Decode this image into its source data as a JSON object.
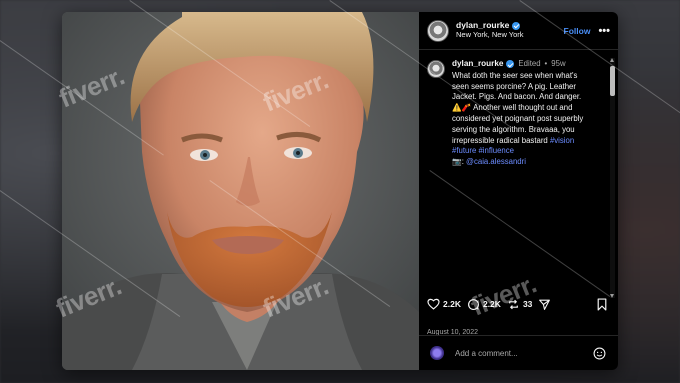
{
  "post": {
    "username": "dylan_rourke",
    "location": "New York, New York",
    "follow_label": "Follow",
    "more_label": "•••",
    "caption": {
      "username": "dylan_rourke",
      "edited": "Edited",
      "dot": "•",
      "age": "95w",
      "line1": "What doth the seer see when what's",
      "line2": "seen seems porcine? A pig. Leather",
      "line3": "Jacket. Pigs. And bacon. And danger.",
      "line4_emoji": "⚠️🧨",
      "line4": " Another well thought out and",
      "line5": "considered yet poignant post superbly",
      "line6": "serving the algorithm. Bravaaa, you",
      "line7a": "irrepressible radical bastard ",
      "hashtag1": "#vision",
      "hashtag2": "#future",
      "hashtag3": "#influence",
      "photo_credit_icon": "📷:",
      "photo_credit_tag": "@caia.alessandri"
    },
    "likes": "2.2K",
    "comments": "2.2K",
    "reposts": "33",
    "date": "August 10, 2022",
    "comment_placeholder": "Add a comment..."
  },
  "watermark": {
    "text": "fiverr."
  },
  "colors": {
    "accent_blue": "#4a8ff7",
    "hashtag": "#6c8cff",
    "verified": "#3897f0",
    "panel_bg": "#000000"
  },
  "icons": [
    "more-icon",
    "verified-icon",
    "heart-icon",
    "comment-icon",
    "repost-icon",
    "share-icon",
    "bookmark-icon",
    "emoji-icon"
  ]
}
